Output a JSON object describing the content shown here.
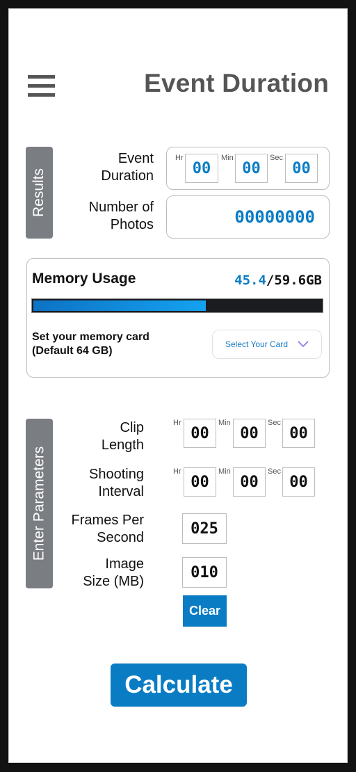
{
  "header": {
    "menu_icon": "hamburger-menu-icon",
    "title": "Event Duration"
  },
  "results": {
    "tab_label": "Results",
    "event_duration": {
      "label_line1": "Event",
      "label_line2": "Duration",
      "hr_label": "Hr",
      "min_label": "Min",
      "sec_label": "Sec",
      "hr": "00",
      "min": "00",
      "sec": "00"
    },
    "number_of_photos": {
      "label_line1": "Number of",
      "label_line2": "Photos",
      "value": "00000000"
    }
  },
  "memory": {
    "title": "Memory Usage",
    "used": "45.4",
    "separator": "/",
    "total": "59.6GB",
    "progress_fraction": 0.6,
    "card_label_line1": "Set your memory card",
    "card_label_line2": "(Default 64 GB)",
    "select_placeholder": "Select Your Card",
    "select_icon": "chevron-down-icon"
  },
  "parameters": {
    "tab_label": "Enter Parameters",
    "clip_length": {
      "label_line1": "Clip",
      "label_line2": "Length",
      "hr_label": "Hr",
      "min_label": "Min",
      "sec_label": "Sec",
      "hr": "00",
      "min": "00",
      "sec": "00"
    },
    "shooting_interval": {
      "label_line1": "Shooting",
      "label_line2": "Interval",
      "hr_label": "Hr",
      "min_label": "Min",
      "sec_label": "Sec",
      "hr": "00",
      "min": "00",
      "sec": "00"
    },
    "fps": {
      "label_line1": "Frames Per",
      "label_line2": "Second",
      "value": "025"
    },
    "image_size": {
      "label_line1": "Image",
      "label_line2": "Size (MB)",
      "value": "010"
    },
    "clear_label": "Clear"
  },
  "calculate_label": "Calculate",
  "colors": {
    "accent": "#0a7cc4",
    "tab_gray": "#7a7d82",
    "title_gray": "#555555",
    "select_chevron": "#9b87e8"
  }
}
